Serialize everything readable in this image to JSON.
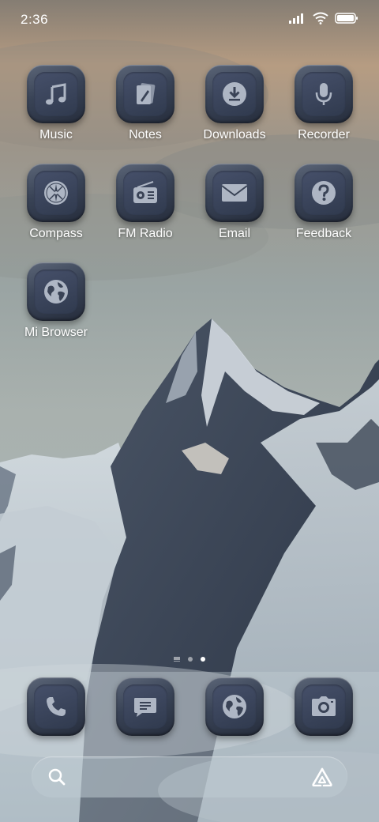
{
  "status_bar": {
    "time": "2:36",
    "icons": [
      "signal-icon",
      "wifi-icon",
      "battery-icon"
    ]
  },
  "apps": [
    {
      "label": "Music",
      "icon": "music-note-icon"
    },
    {
      "label": "Notes",
      "icon": "notes-icon"
    },
    {
      "label": "Downloads",
      "icon": "download-icon"
    },
    {
      "label": "Recorder",
      "icon": "microphone-icon"
    },
    {
      "label": "Compass",
      "icon": "compass-icon"
    },
    {
      "label": "FM Radio",
      "icon": "radio-icon"
    },
    {
      "label": "Email",
      "icon": "envelope-icon"
    },
    {
      "label": "Feedback",
      "icon": "question-mark-icon"
    },
    {
      "label": "Mi Browser",
      "icon": "globe-icon"
    }
  ],
  "page_indicator": {
    "pages": 2,
    "current": 2
  },
  "dock": [
    {
      "icon": "phone-icon"
    },
    {
      "icon": "message-icon"
    },
    {
      "icon": "globe-icon"
    },
    {
      "icon": "camera-icon"
    }
  ],
  "search_bar": {
    "left_icon": "search-icon",
    "right_icon": "assistant-icon"
  },
  "colors": {
    "icon_tile": "#394356",
    "icon_glyph": "#aeb6c4",
    "label": "#ffffff"
  }
}
